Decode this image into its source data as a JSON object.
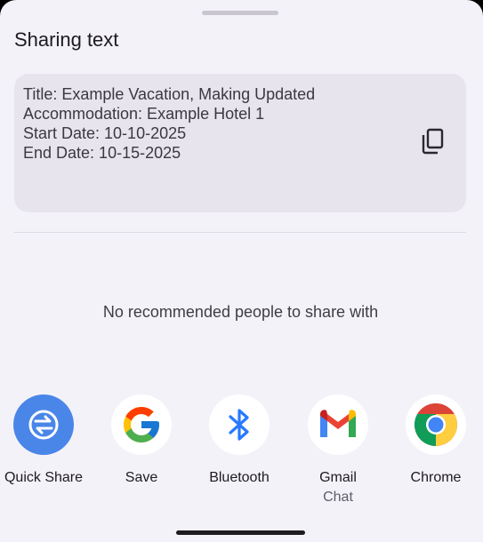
{
  "sheet": {
    "title": "Sharing text"
  },
  "preview": {
    "lines": [
      "Title: Example Vacation, Making Updated",
      "Accommodation: Example Hotel 1",
      "Start Date: 10-10-2025",
      "End Date: 10-15-2025"
    ],
    "copy_icon": "copy-icon"
  },
  "recommendations": {
    "empty_message": "No recommended people to share with"
  },
  "targets": [
    {
      "label": "Quick Share",
      "icon": "quick-share-icon"
    },
    {
      "label": "Save",
      "icon": "google-icon"
    },
    {
      "label": "Bluetooth",
      "icon": "bluetooth-icon"
    },
    {
      "label": "Gmail",
      "sublabel": "Chat",
      "icon": "gmail-icon"
    },
    {
      "label": "Chrome",
      "icon": "chrome-icon"
    }
  ],
  "colors": {
    "sheet_bg": "#f4f2f9",
    "card_bg": "#e7e4ee",
    "quick_share": "#4a86e8",
    "bluetooth": "#2979ff"
  }
}
